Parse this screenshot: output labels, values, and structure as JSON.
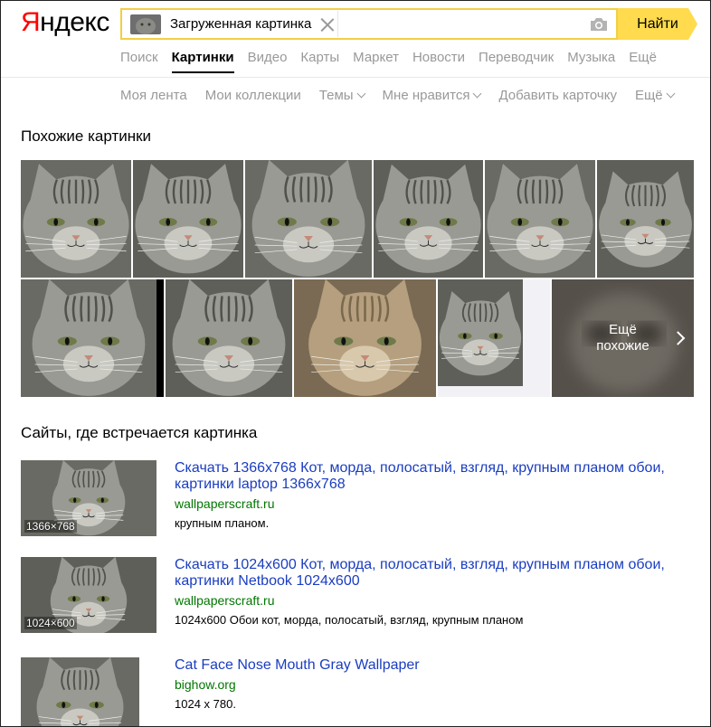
{
  "logo": {
    "first": "Я",
    "rest": "ндекс"
  },
  "search": {
    "chip_text": "Загруженная картинка",
    "value": "",
    "button_label": "Найти"
  },
  "nav": [
    "Поиск",
    "Картинки",
    "Видео",
    "Карты",
    "Маркет",
    "Новости",
    "Переводчик",
    "Музыка",
    "Ещё"
  ],
  "nav_active_index": 1,
  "subnav": [
    {
      "label": "Моя лента",
      "dropdown": false
    },
    {
      "label": "Мои коллекции",
      "dropdown": false
    },
    {
      "label": "Темы",
      "dropdown": true
    },
    {
      "label": "Мне нравится",
      "dropdown": true
    },
    {
      "label": "Добавить карточку",
      "dropdown": false
    },
    {
      "label": "Ещё",
      "dropdown": true
    }
  ],
  "similar": {
    "heading": "Похожие картинки",
    "more_line1": "Ещё",
    "more_line2": "похожие"
  },
  "sites": {
    "heading": "Сайты, где встречается картинка",
    "results": [
      {
        "title": "Скачать 1366x768 Кот, морда, полосатый, взгляд, крупным планом обои, картинки laptop 1366x768",
        "url": "wallpaperscraft.ru",
        "desc": "крупным планом.",
        "size": "1366×768"
      },
      {
        "title": "Скачать 1024x600 Кот, морда, полосатый, взгляд, крупным планом обои, картинки Netbook 1024x600",
        "url": "wallpaperscraft.ru",
        "desc": "1024x600 Обои кот, морда, полосатый, взгляд, крупным планом",
        "size": "1024×600"
      },
      {
        "title": "Cat Face Nose Mouth Gray Wallpaper",
        "url": "bighow.org",
        "desc": "1024 x 780.",
        "size": ""
      }
    ]
  },
  "colors": {
    "brand_red": "#ff0000",
    "search_border": "#f2cf45",
    "button_yellow": "#ffdb4d",
    "link_blue": "#1a3dc1",
    "url_green": "#007700",
    "muted_grey": "#999999"
  }
}
